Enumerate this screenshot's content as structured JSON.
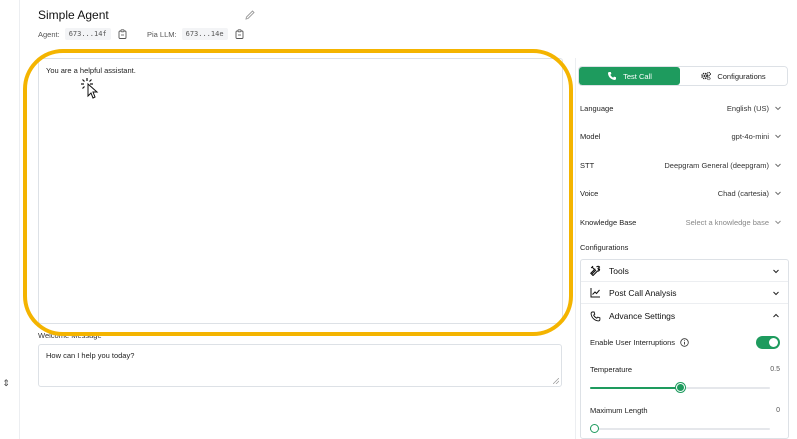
{
  "agent": {
    "title": "Simple Agent",
    "agent_label": "Agent:",
    "agent_id": "673...14f",
    "llm_label": "Pia LLM:",
    "llm_id": "673...14e"
  },
  "prompt": {
    "text": "You are a helpful assistant."
  },
  "welcome": {
    "label": "Welcome Message",
    "text": "How can I help you today?"
  },
  "actions": {
    "test_call": "Test Call",
    "configurations": "Configurations"
  },
  "settings": [
    {
      "label": "Language",
      "value": "English (US)"
    },
    {
      "label": "Model",
      "value": "gpt-4o-mini"
    },
    {
      "label": "STT",
      "value": "Deepgram General (deepgram)"
    },
    {
      "label": "Voice",
      "value": "Chad (cartesia)"
    },
    {
      "label": "Knowledge Base",
      "value": "Select a knowledge base"
    }
  ],
  "configurations": {
    "title": "Configurations",
    "tools": "Tools",
    "post_call": "Post Call Analysis",
    "advanced": "Advance Settings",
    "interruptions_label": "Enable User Interruptions",
    "interruptions_enabled": true,
    "temperature_label": "Temperature",
    "temperature_value": "0.5",
    "temperature_fraction": 0.5,
    "max_length_label": "Maximum Length",
    "max_length_value": "0",
    "max_length_fraction": 0
  },
  "colors": {
    "accent": "#1e9b5e",
    "highlight": "#f4b400"
  }
}
